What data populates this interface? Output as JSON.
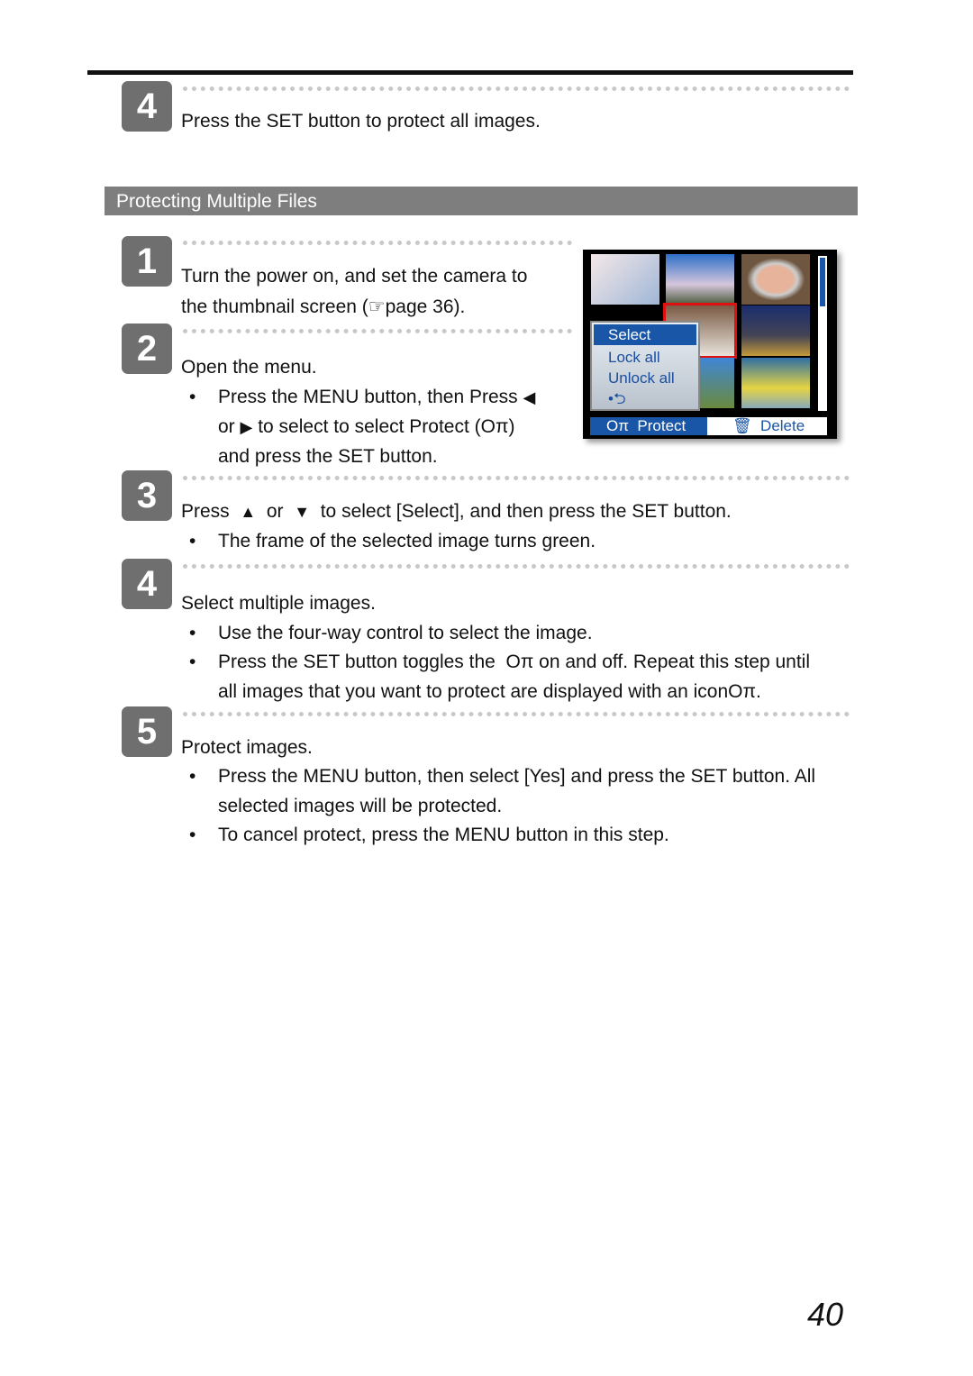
{
  "prev_step": {
    "number": "4",
    "text": "Press the SET button to protect all images."
  },
  "section_title": "Protecting Multiple Files",
  "steps": [
    {
      "number": "1",
      "line1": "Turn the power on, and set the camera to",
      "line2_pre": "the thumbnail screen (",
      "line2_post": "page 36)."
    },
    {
      "number": "2",
      "title": "Open the menu.",
      "b1_a": "Press the ",
      "b1_menu": "MENU",
      "b1_b": " button, then Press",
      "b1_c": "or",
      "b1_d": " to select to select ",
      "b1_protect": "Protect",
      "b1_e": " (",
      "b1_f": ")",
      "b1_g": "and press the ",
      "b1_set": "SET",
      "b1_h": " button."
    },
    {
      "number": "3",
      "title_a": "Press",
      "title_b": "or",
      "title_c": "to select [Select], and then press the SET button.",
      "bullet1": "The frame of the selected image turns green."
    },
    {
      "number": "4",
      "title": "Select multiple images.",
      "bullet1": "Use the four-way control to select the image.",
      "b2_a": "Press the ",
      "b2_set": "SET",
      "b2_b": " button toggles the",
      "b2_c": " on and off. Repeat this step until",
      "b2_d": "all images that you want to protect are displayed with an icon",
      "b2_e": "."
    },
    {
      "number": "5",
      "title": "Protect images.",
      "b1_a": "Press the ",
      "b1_menu": "MENU",
      "b1_b": " button, then select ",
      "b1_yes": "[Yes]",
      "b1_c": " and press the ",
      "b1_set": "SET",
      "b1_d": " button. All",
      "b1_e": "selected images will be protected.",
      "b2_a": "To cancel protect, press the ",
      "b2_menu": "MENU",
      "b2_b": " button in this step."
    }
  ],
  "camera_screen": {
    "menu_items": [
      "Select",
      "Lock all",
      "Unlock all",
      "•⮌"
    ],
    "bottom_bar": {
      "protect": "Protect",
      "delete": "Delete"
    },
    "key_glyph": "Oπ"
  },
  "glyphs": {
    "left": "◀",
    "right": "▶",
    "up": "▲",
    "down": "▼",
    "hand": "☞",
    "bullet": "•",
    "key": "Oπ"
  },
  "page_number": "40"
}
